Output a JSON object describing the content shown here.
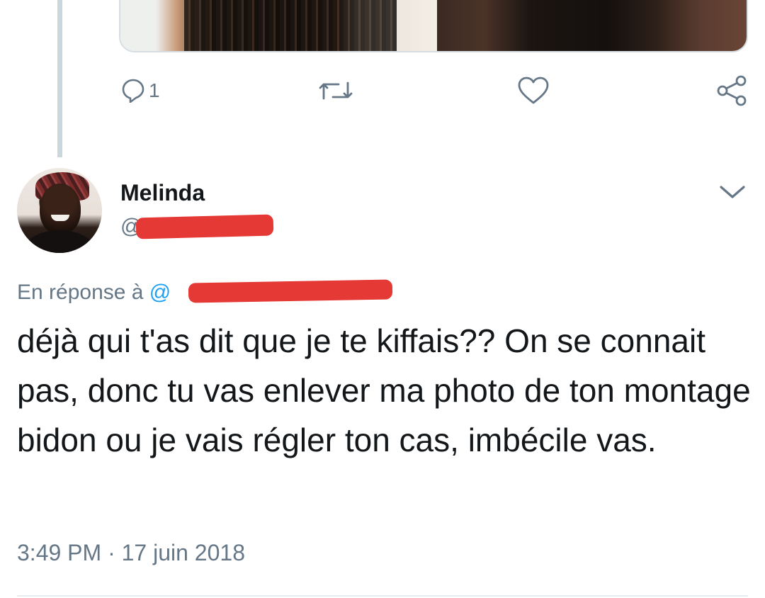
{
  "prev_tweet": {
    "reply_count": "1"
  },
  "tweet": {
    "display_name": "Melinda",
    "handle": "@",
    "in_reply_prefix": "En réponse à ",
    "in_reply_mention": "@",
    "text": "déjà qui t'as dit que je te kiffais?? On se connait pas, donc tu vas enlever ma photo de ton montage bidon ou je vais régler ton cas, imbécile vas.",
    "timestamp": "3:49 PM · 17 juin 2018"
  },
  "colors": {
    "accent": "#1da1f2",
    "secondary_text": "#657786",
    "redaction": "#e53935"
  },
  "icons": [
    "reply-icon",
    "retweet-icon",
    "like-icon",
    "share-icon",
    "chevron-down-icon"
  ]
}
